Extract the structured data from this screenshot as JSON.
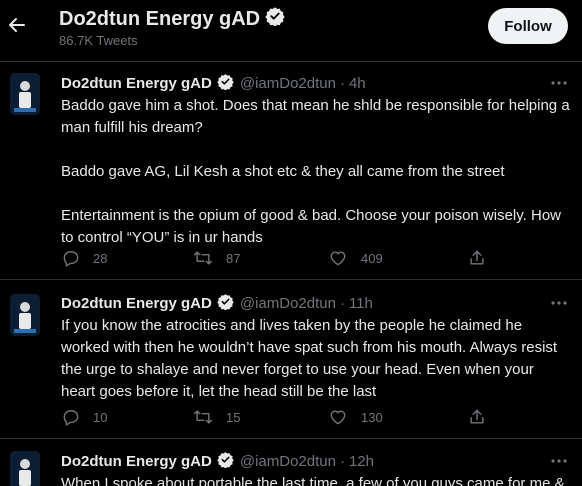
{
  "header": {
    "profile_name": "Do2dtun Energy gAD",
    "tweet_count": "86.7K Tweets",
    "follow_label": "Follow"
  },
  "tweets": [
    {
      "name": "Do2dtun Energy gAD",
      "handle": "@iamDo2dtun",
      "time": "4h",
      "text": [
        "Baddo gave him a shot. Does that mean he shld be responsible for helping a man fulfill his dream?",
        "Baddo gave AG, Lil Kesh a shot etc & they all came from the street",
        "Entertainment is the opium of good & bad. Choose your poison wisely. How to control “YOU” is in ur hands"
      ],
      "replies": "28",
      "retweets": "87",
      "likes": "409"
    },
    {
      "name": "Do2dtun Energy gAD",
      "handle": "@iamDo2dtun",
      "time": "11h",
      "text": [
        "If you know the atrocities and lives taken by the people he claimed he worked with then he wouldn’t have spat such from his mouth. Always resist the urge to shalaye and never forget to use your head. Even when your heart goes before it, let the head still be the last"
      ],
      "replies": "10",
      "retweets": "15",
      "likes": "130"
    },
    {
      "name": "Do2dtun Energy gAD",
      "handle": "@iamDo2dtun",
      "time": "12h",
      "text": [
        "When I spoke about portable the last time, a few of you guys came for me &"
      ]
    }
  ],
  "colors": {
    "background": "#000000",
    "text": "#e7e9ea",
    "muted": "#71767b",
    "divider": "#2f3336",
    "verified": "#e7e9ea"
  },
  "icons": [
    "back-arrow-icon",
    "verified-badge-icon",
    "more-icon",
    "reply-icon",
    "retweet-icon",
    "like-icon",
    "share-icon"
  ]
}
